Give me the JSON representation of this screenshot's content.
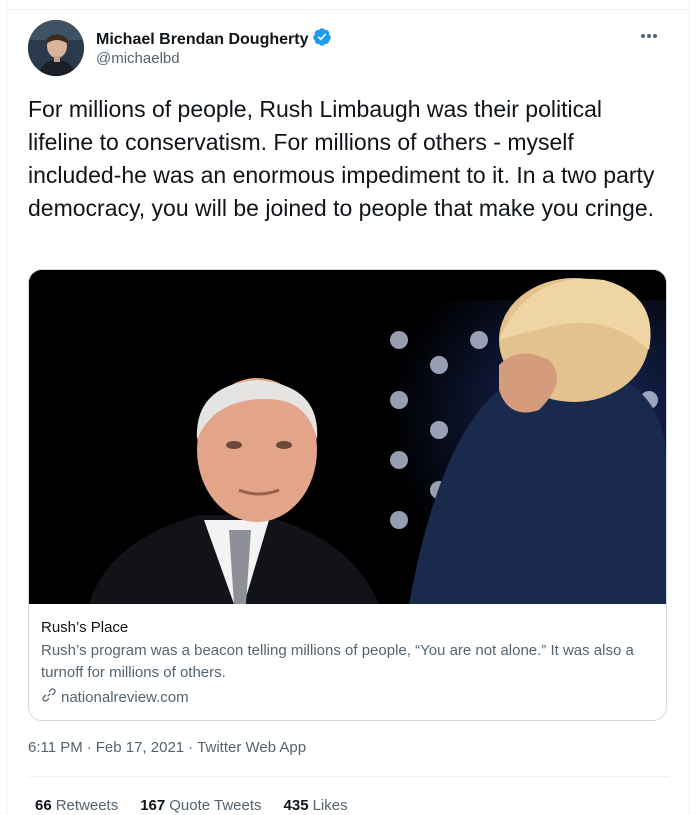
{
  "author": {
    "name": "Michael Brendan Dougherty",
    "handle": "@michaelbd",
    "verified": true
  },
  "tweet": {
    "text": "For millions of people, Rush Limbaugh was their political lifeline to conservatism. For millions of others - myself included-he was an enormous impediment to it. In a two party democracy, you will be joined to people that make you cringe."
  },
  "card": {
    "title": "Rush’s Place",
    "description": "Rush’s program was a beacon telling millions of people, “You are not alone.” It was also a turnoff for millions of others.",
    "domain": "nationalreview.com"
  },
  "meta": {
    "time": "6:11 PM",
    "separator": "·",
    "date": "Feb 17, 2021",
    "app": "Twitter Web App"
  },
  "stats": [
    {
      "count": "66",
      "label": "Retweets"
    },
    {
      "count": "167",
      "label": "Quote Tweets"
    },
    {
      "count": "435",
      "label": "Likes"
    }
  ],
  "colors": {
    "verified_blue": "#1d9bf0",
    "secondary_text": "#536471",
    "border": "#cfd9de"
  },
  "icons": {
    "verified": "verified-badge-icon",
    "more": "more-options-icon",
    "link": "link-icon"
  }
}
